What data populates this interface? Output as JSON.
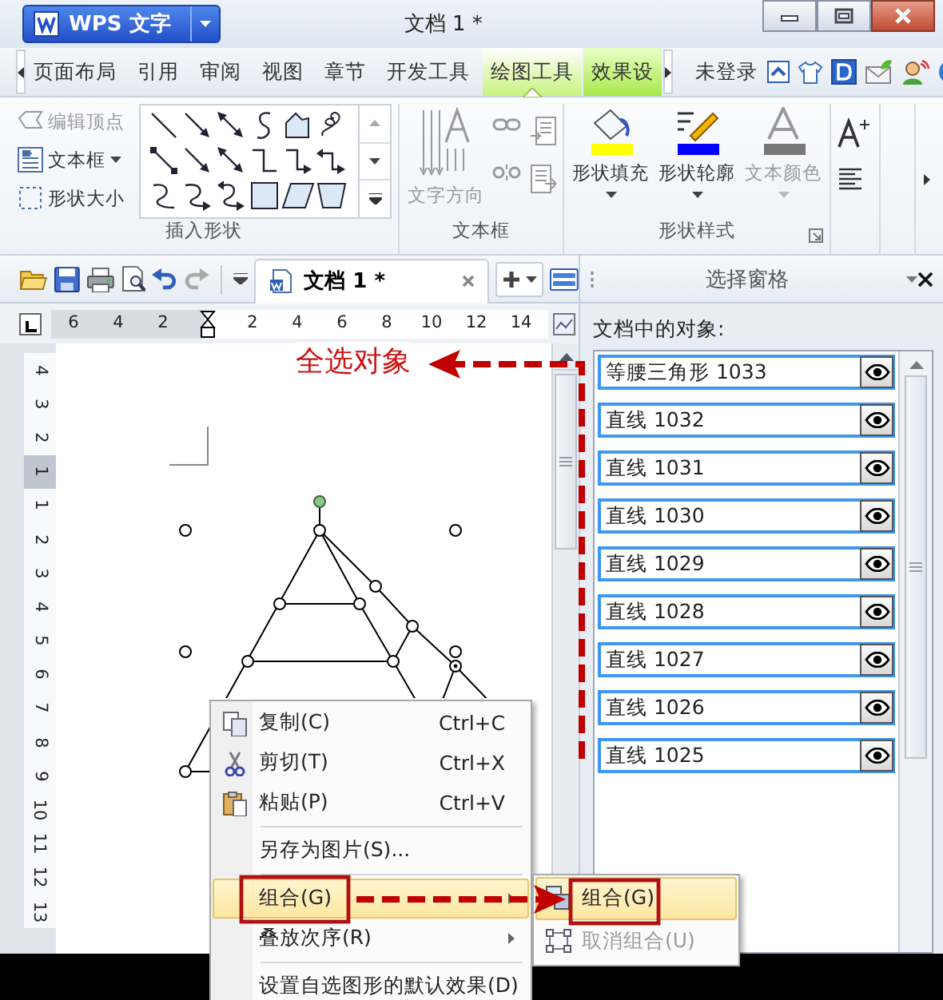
{
  "app_menu": {
    "label": "WPS 文字"
  },
  "window": {
    "title": "文档 1 *"
  },
  "ribbon_tabs": [
    {
      "label": "页面布局",
      "selected": false,
      "contextual": false
    },
    {
      "label": "引用",
      "selected": false,
      "contextual": false
    },
    {
      "label": "审阅",
      "selected": false,
      "contextual": false
    },
    {
      "label": "视图",
      "selected": false,
      "contextual": false
    },
    {
      "label": "章节",
      "selected": false,
      "contextual": false
    },
    {
      "label": "开发工具",
      "selected": false,
      "contextual": false
    },
    {
      "label": "绘图工具",
      "selected": true,
      "contextual": true
    },
    {
      "label": "效果设",
      "selected": false,
      "contextual": true
    }
  ],
  "account": {
    "label": "未登录"
  },
  "ribbon_groups": [
    {
      "label": "插入形状",
      "tools": [
        {
          "kind": "small",
          "label": "编辑顶点",
          "disabled": true,
          "dropdown": false
        },
        {
          "kind": "small",
          "label": "文本框",
          "disabled": false,
          "dropdown": true
        },
        {
          "kind": "small",
          "label": "形状大小",
          "disabled": false,
          "dropdown": false
        },
        {
          "kind": "gallery"
        }
      ]
    },
    {
      "label": "文本框",
      "tools": [
        {
          "kind": "large",
          "label": "文字方向",
          "disabled": true
        },
        {
          "kind": "link_tools"
        }
      ]
    },
    {
      "label": "形状样式",
      "tools": [
        {
          "kind": "swatch",
          "label": "形状填充",
          "color": "#ffff00",
          "disabled": false
        },
        {
          "kind": "swatch",
          "label": "形状轮廓",
          "color": "#0000ff",
          "disabled": false
        },
        {
          "kind": "swatch",
          "label": "文本颜色",
          "color": "#777777",
          "disabled": true
        }
      ]
    },
    {
      "tools": [
        {
          "kind": "text_tools"
        }
      ]
    }
  ],
  "document_tab": {
    "label": "文档 1 *"
  },
  "horizontal_ruler": {
    "ticks": [
      {
        "kind": "number",
        "label": "6"
      },
      {
        "kind": "number",
        "label": "4"
      },
      {
        "kind": "number",
        "label": "2"
      },
      {
        "kind": "indent"
      },
      {
        "kind": "number",
        "label": "2"
      },
      {
        "kind": "number",
        "label": "4"
      },
      {
        "kind": "number",
        "label": "6"
      },
      {
        "kind": "number",
        "label": "8"
      },
      {
        "kind": "number",
        "label": "10"
      },
      {
        "kind": "number",
        "label": "12"
      },
      {
        "kind": "number",
        "label": "14"
      }
    ]
  },
  "vertical_ruler": {
    "ticks": [
      {
        "label": "4",
        "margin": false
      },
      {
        "label": "3",
        "margin": false
      },
      {
        "label": "2",
        "margin": false
      },
      {
        "label": "1",
        "margin": true
      },
      {
        "label": "1",
        "margin": false
      },
      {
        "label": "2",
        "margin": false
      },
      {
        "label": "3",
        "margin": false
      },
      {
        "label": "4",
        "margin": false
      },
      {
        "label": "5",
        "margin": false
      },
      {
        "label": "6",
        "margin": false
      },
      {
        "label": "7",
        "margin": false
      },
      {
        "label": "8",
        "margin": false
      },
      {
        "label": "9",
        "margin": false
      },
      {
        "label": "10",
        "margin": false
      },
      {
        "label": "11",
        "margin": false
      },
      {
        "label": "12",
        "margin": false
      },
      {
        "label": "13",
        "margin": false
      }
    ]
  },
  "selection_pane": {
    "title": "选择窗格",
    "heading": "文档中的对象:",
    "objects": [
      {
        "name": "等腰三角形 1033",
        "selected": true,
        "visible": true
      },
      {
        "name": "直线 1032",
        "selected": true,
        "visible": true
      },
      {
        "name": "直线 1031",
        "selected": true,
        "visible": true
      },
      {
        "name": "直线 1030",
        "selected": true,
        "visible": true
      },
      {
        "name": "直线 1029",
        "selected": true,
        "visible": true
      },
      {
        "name": "直线 1028",
        "selected": true,
        "visible": true
      },
      {
        "name": "直线 1027",
        "selected": true,
        "visible": true
      },
      {
        "name": "直线 1026",
        "selected": true,
        "visible": true
      },
      {
        "name": "直线 1025",
        "selected": true,
        "visible": true
      }
    ]
  },
  "context_menu": {
    "items": [
      {
        "kind": "command",
        "label": "复制(C)",
        "shortcut": "Ctrl+C",
        "selected": false,
        "has_submenu": false
      },
      {
        "kind": "command",
        "label": "剪切(T)",
        "shortcut": "Ctrl+X",
        "selected": false,
        "has_submenu": false
      },
      {
        "kind": "command",
        "label": "粘贴(P)",
        "shortcut": "Ctrl+V",
        "selected": false,
        "has_submenu": false
      },
      {
        "kind": "separator"
      },
      {
        "kind": "command",
        "label": "另存为图片(S)...",
        "selected": false,
        "has_submenu": false
      },
      {
        "kind": "separator"
      },
      {
        "kind": "command",
        "label": "组合(G)",
        "selected": true,
        "has_submenu": true
      },
      {
        "kind": "command",
        "label": "叠放次序(R)",
        "selected": false,
        "has_submenu": true
      },
      {
        "kind": "separator"
      },
      {
        "kind": "command",
        "label": "设置自选图形的默认效果(D)",
        "selected": false,
        "has_submenu": false
      }
    ]
  },
  "submenu": {
    "items": [
      {
        "label": "组合(G)",
        "selected": true,
        "disabled": false
      },
      {
        "label": "取消组合(U)",
        "selected": false,
        "disabled": true
      }
    ]
  },
  "annotations": {
    "callout": "全选对象"
  }
}
